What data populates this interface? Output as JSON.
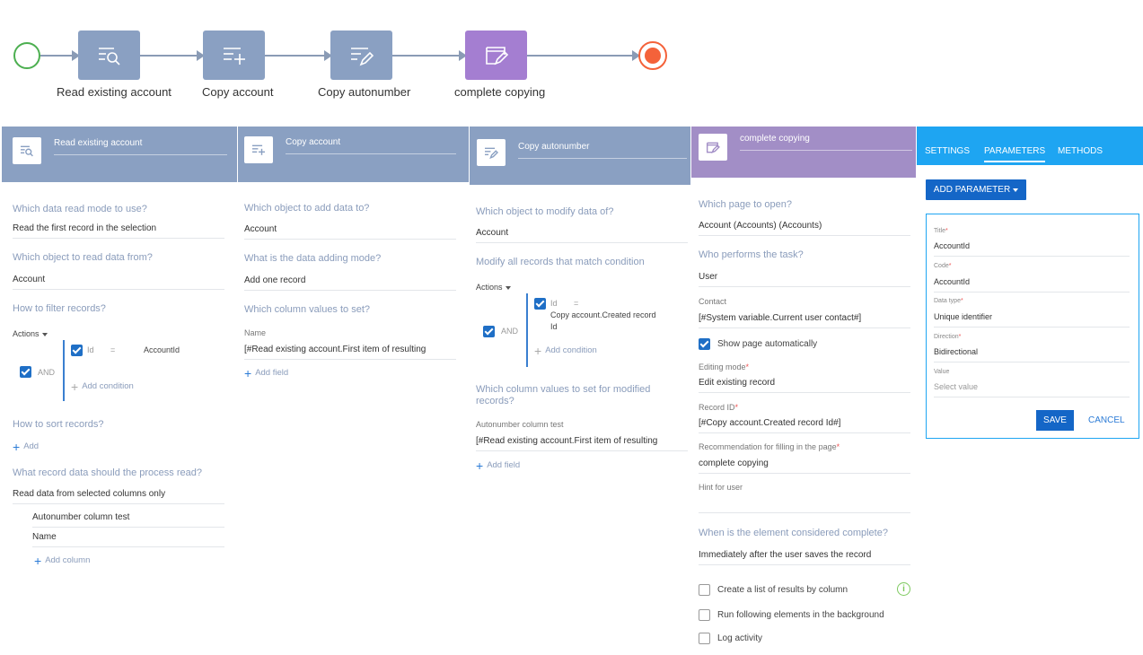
{
  "colors": {
    "task": "#8aa0c2",
    "task_purple": "#a47ed1",
    "start": "#4caf50",
    "end": "#f4623a",
    "accent": "#1466c7",
    "tabs": "#1ea5f2"
  },
  "flow": {
    "tasks": [
      {
        "label": "Read existing account",
        "icon": "read-data-icon"
      },
      {
        "label": "Copy account",
        "icon": "add-data-icon"
      },
      {
        "label": "Copy autonumber",
        "icon": "modify-data-icon"
      },
      {
        "label": "complete copying",
        "icon": "open-page-icon"
      }
    ]
  },
  "read_panel": {
    "title": "Read existing account",
    "q_mode": "Which data read mode to use?",
    "mode": "Read the first record in the selection",
    "q_object": "Which object to read data from?",
    "object": "Account",
    "q_filter": "How to filter records?",
    "actions": "Actions",
    "and": "AND",
    "filter_field": "Id",
    "filter_op": "=",
    "filter_value": "AccountId",
    "add_condition": "Add condition",
    "q_sort": "How to sort records?",
    "add": "Add",
    "q_data": "What record data should the process read?",
    "data_mode": "Read data from selected columns only",
    "columns": [
      "Autonumber column test",
      "Name"
    ],
    "add_column": "Add column"
  },
  "copy_panel": {
    "title": "Copy account",
    "q_object": "Which object to add data to?",
    "object": "Account",
    "q_mode": "What is the data adding mode?",
    "mode": "Add one record",
    "q_columns": "Which column values to set?",
    "field_label": "Name",
    "field_value": "[#Read existing account.First item of resulting",
    "add_field": "Add field"
  },
  "autonumber_panel": {
    "title": "Copy autonumber",
    "q_object": "Which object to modify data of?",
    "object": "Account",
    "q_modify": "Modify all records that match condition",
    "actions": "Actions",
    "and": "AND",
    "cond_field": "Id",
    "cond_op": "=",
    "cond_value_1": "Copy account.Created record",
    "cond_value_2": "Id",
    "add_condition": "Add condition",
    "q_columns_1": "Which column values to set for modified",
    "q_columns_2": "records?",
    "field_label": "Autonumber column test",
    "field_value": "[#Read existing account.First item of resulting",
    "add_field": "Add field"
  },
  "complete_panel": {
    "title": "complete copying",
    "q_page": "Which page to open?",
    "page": "Account (Accounts) (Accounts)",
    "q_who": "Who performs the task?",
    "who": "User",
    "contact_label": "Contact",
    "contact": "[#System variable.Current user contact#]",
    "show_page": "Show page automatically",
    "editing_label": "Editing mode",
    "editing": "Edit existing record",
    "record_label": "Record ID",
    "record": "[#Copy account.Created record Id#]",
    "rec_label": "Recommendation for filling in the page",
    "rec": "complete copying",
    "hint_label": "Hint for user",
    "q_complete": "When is the element considered complete?",
    "complete": "Immediately after the user saves the record",
    "opt_list": "Create a list of results by column",
    "opt_background": "Run following elements in the background",
    "opt_log": "Log activity"
  },
  "right_panel": {
    "tabs": [
      "SETTINGS",
      "PARAMETERS",
      "METHODS"
    ],
    "add_parameter": "ADD PARAMETER",
    "title_label": "Title",
    "title": "AccountId",
    "code_label": "Code",
    "code": "AccountId",
    "type_label": "Data type",
    "type": "Unique identifier",
    "direction_label": "Direction",
    "direction": "Bidirectional",
    "value_label": "Value",
    "value_placeholder": "Select value",
    "save": "SAVE",
    "cancel": "CANCEL"
  }
}
